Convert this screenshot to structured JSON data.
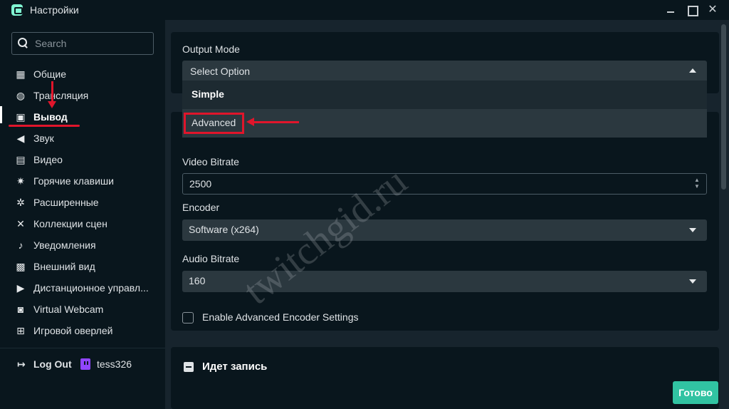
{
  "window": {
    "title": "Настройки",
    "controls": [
      "minimize",
      "maximize",
      "close"
    ],
    "close_glyph": "✕"
  },
  "sidebar": {
    "search_placeholder": "Search",
    "items": [
      {
        "label": "Общие",
        "icon": "grid-icon",
        "glyph": "▦"
      },
      {
        "label": "Трансляция",
        "icon": "globe-icon",
        "glyph": "◍"
      },
      {
        "label": "Вывод",
        "icon": "chip-icon",
        "glyph": "▣",
        "active": true
      },
      {
        "label": "Звук",
        "icon": "speaker-icon",
        "glyph": "◀"
      },
      {
        "label": "Видео",
        "icon": "film-icon",
        "glyph": "▤"
      },
      {
        "label": "Горячие клавиши",
        "icon": "gear-icon",
        "glyph": "✷"
      },
      {
        "label": "Расширенные",
        "icon": "gears-icon",
        "glyph": "✲"
      },
      {
        "label": "Коллекции сцен",
        "icon": "tools-icon",
        "glyph": "✕"
      },
      {
        "label": "Уведомления",
        "icon": "bell-icon",
        "glyph": "♪"
      },
      {
        "label": "Внешний вид",
        "icon": "palette-icon",
        "glyph": "▩"
      },
      {
        "label": "Дистанционное управл...",
        "icon": "play-circle-icon",
        "glyph": "▶"
      },
      {
        "label": "Virtual Webcam",
        "icon": "camera-icon",
        "glyph": "◙"
      },
      {
        "label": "Игровой оверлей",
        "icon": "overlay-icon",
        "glyph": "⊞"
      }
    ],
    "logout_label": "Log Out",
    "logout_glyph": "↦",
    "username": "tess326"
  },
  "output": {
    "mode_label": "Output Mode",
    "mode_value": "Select Option",
    "mode_options": [
      "Simple",
      "Advanced"
    ],
    "video_bitrate_label": "Video Bitrate",
    "video_bitrate_value": "2500",
    "encoder_label": "Encoder",
    "encoder_value": "Software (x264)",
    "audio_bitrate_label": "Audio Bitrate",
    "audio_bitrate_value": "160",
    "advanced_encoder_label": "Enable Advanced Encoder Settings",
    "advanced_encoder_checked": false
  },
  "recording": {
    "title": "Идет запись"
  },
  "footer": {
    "done_label": "Готово"
  },
  "watermark": "twitchgid.ru",
  "colors": {
    "background": "#09161d",
    "panel": "#17242d",
    "accent": "#31c3a2",
    "annotation_red": "#e0152b",
    "twitch_purple": "#9146ff"
  }
}
